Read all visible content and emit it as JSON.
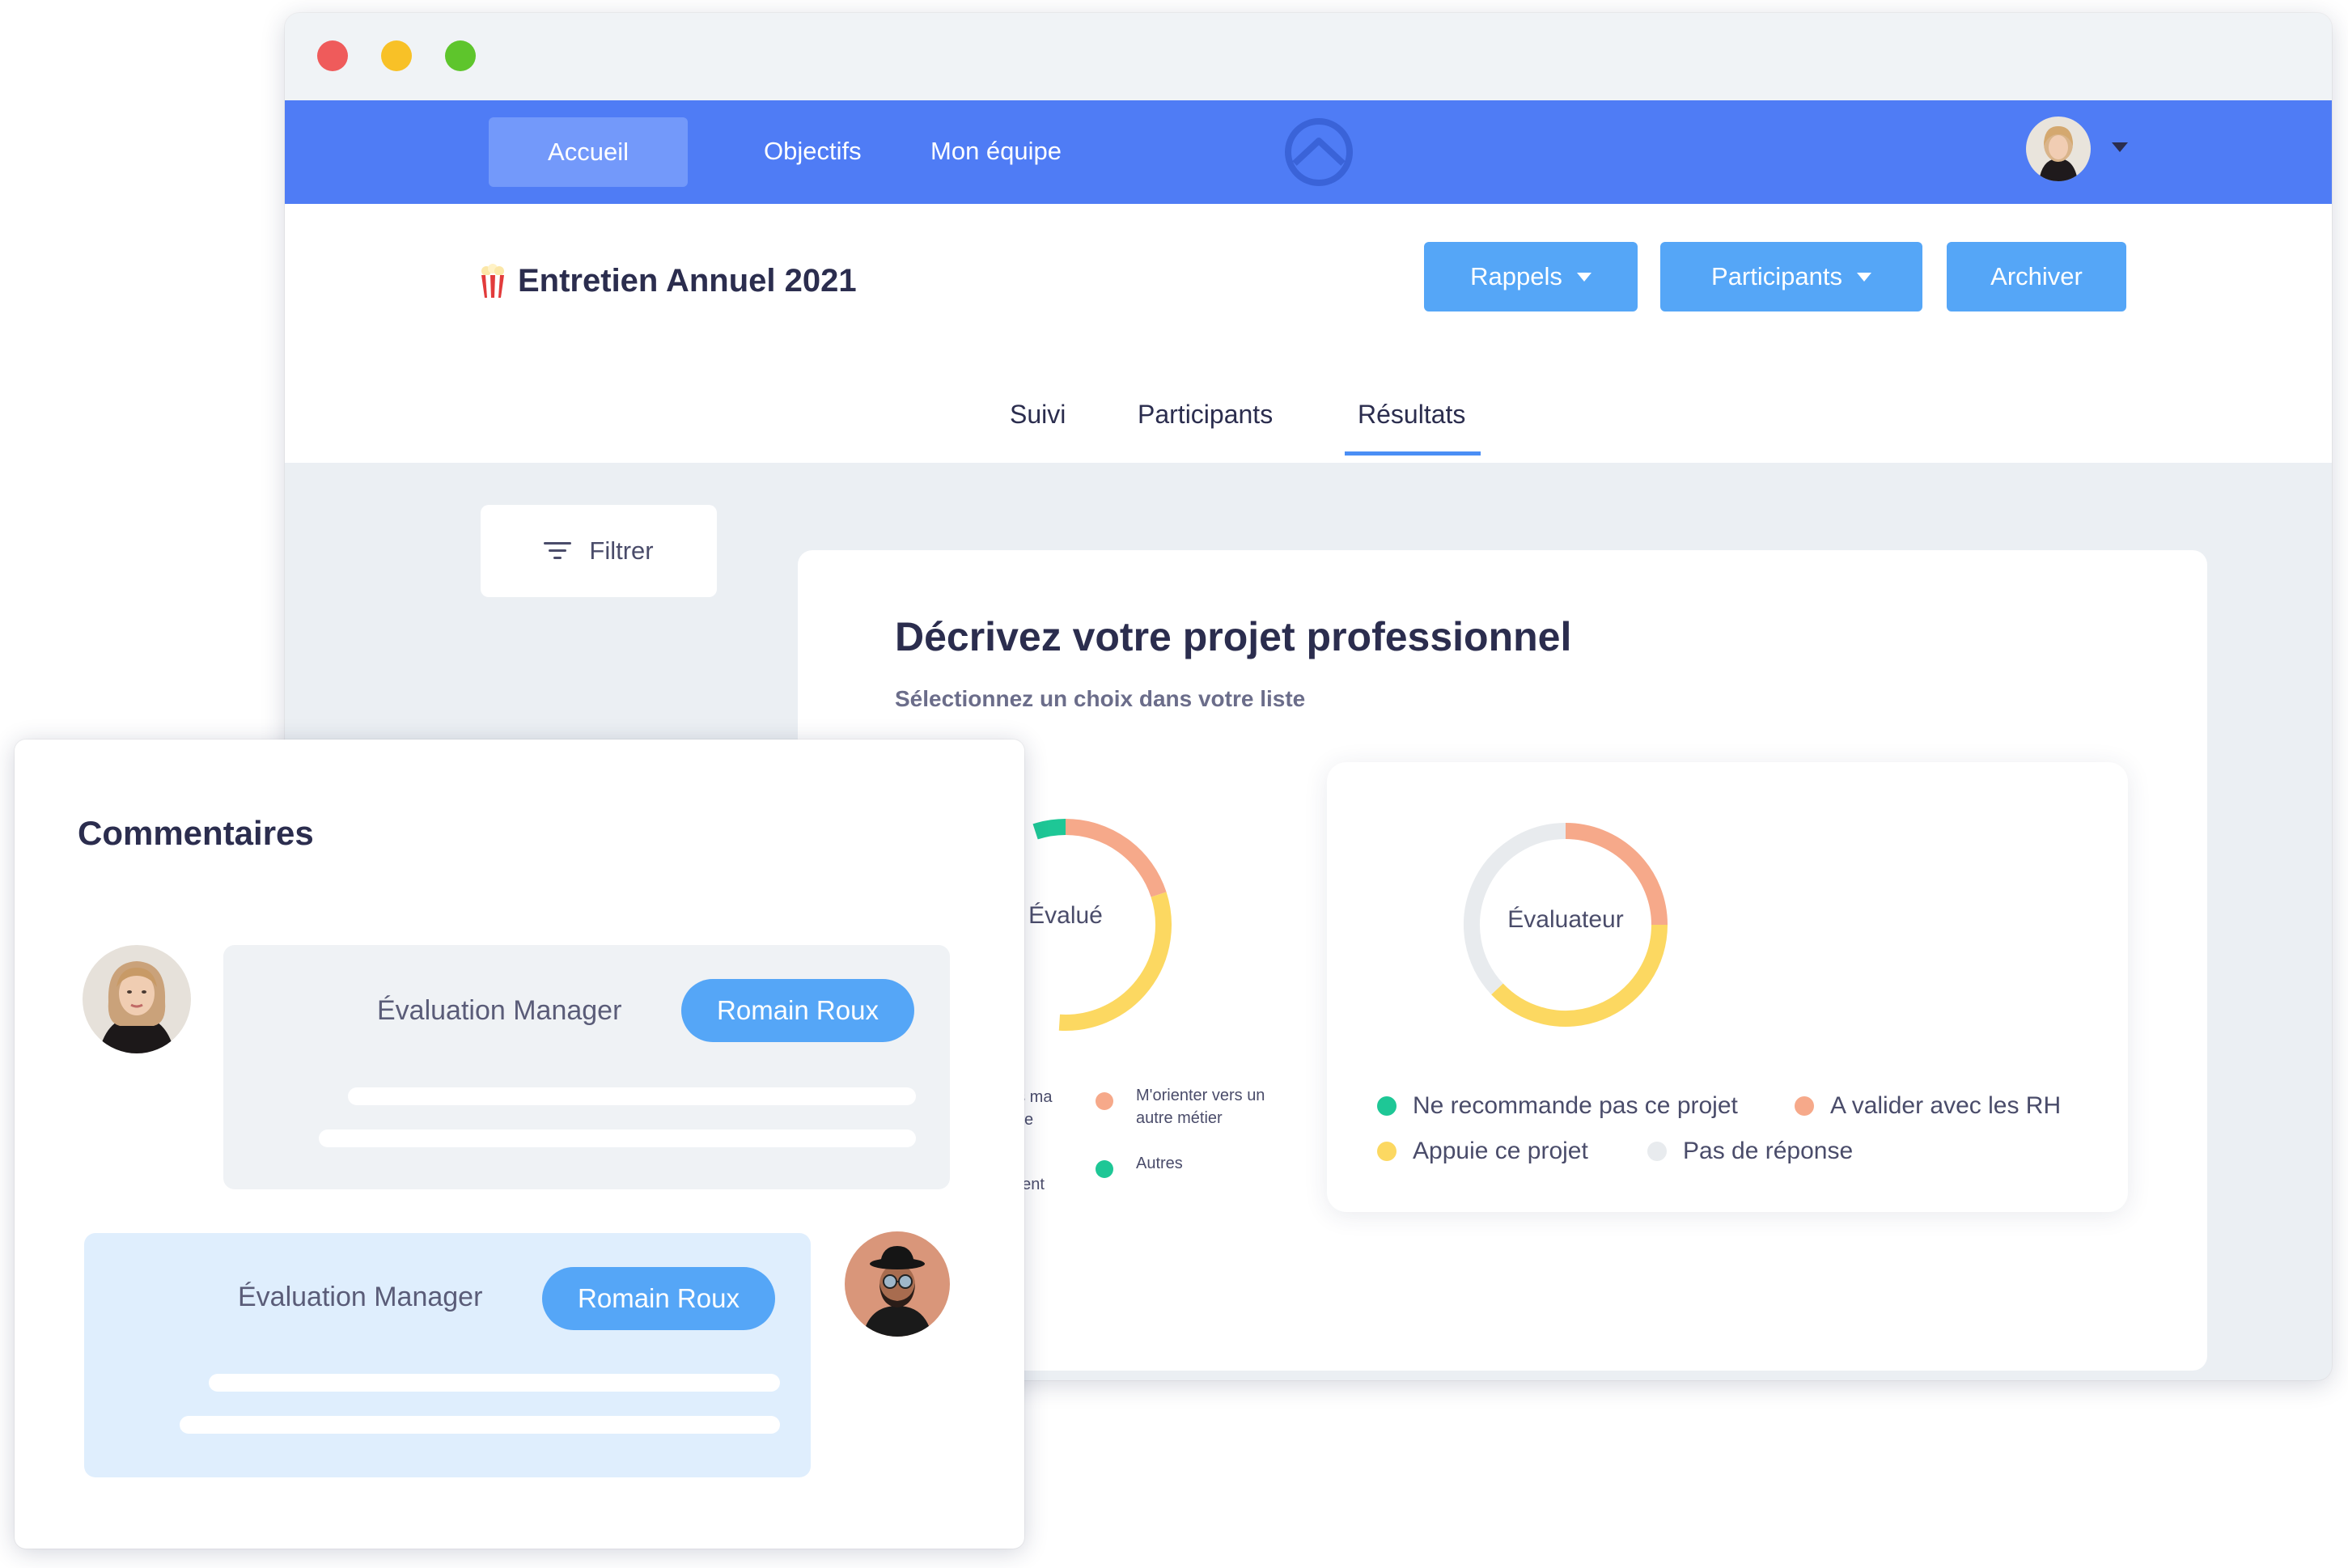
{
  "nav": {
    "items": [
      "Accueil",
      "Objectifs",
      "Mon équipe"
    ],
    "active": "Accueil"
  },
  "header": {
    "title": "Entretien Annuel 2021",
    "buttons": {
      "rappels": "Rappels",
      "participants": "Participants",
      "archiver": "Archiver"
    }
  },
  "tabs": [
    "Suivi",
    "Participants",
    "Résultats"
  ],
  "active_tab": "Résultats",
  "filter": {
    "label": "Filtrer"
  },
  "question": {
    "title": "Décrivez votre projet professionnel",
    "subtitle": "Sélectionnez un choix dans votre liste"
  },
  "chart_data": [
    {
      "type": "pie",
      "title": "Évalué",
      "legend": [
        {
          "label": "ns ma\nelle",
          "color": ""
        },
        {
          "label": "M'orienter vers un autre métier",
          "color": "#f6a98a"
        },
        {
          "label": "nent",
          "color": ""
        },
        {
          "label": "Autres",
          "color": "#1ec796"
        }
      ],
      "visible_segments": [
        {
          "color": "#1ec796",
          "share": 0.05
        },
        {
          "color": "#f6a98a",
          "share": 0.2
        },
        {
          "color": "#fcd861",
          "share": 0.31
        }
      ]
    },
    {
      "type": "pie",
      "title": "Évaluateur",
      "legend": [
        {
          "label": "Ne recommande pas ce projet",
          "color": "#1ec796"
        },
        {
          "label": "A valider avec les RH",
          "color": "#f6a98a"
        },
        {
          "label": "Appuie ce projet",
          "color": "#fcd861"
        },
        {
          "label": "Pas de réponse",
          "color": "#e8ebee"
        }
      ],
      "segments": [
        {
          "label": "A valider avec les RH",
          "share": 0.25,
          "color": "#f6a98a"
        },
        {
          "label": "Appuie ce projet",
          "share": 0.38,
          "color": "#fcd861"
        },
        {
          "label": "Pas de réponse",
          "share": 0.37,
          "color": "#e8ebee"
        }
      ]
    }
  ],
  "comments": {
    "title": "Commentaires",
    "items": [
      {
        "label": "Évaluation Manager",
        "author": "Romain Roux"
      },
      {
        "label": "Évaluation Manager",
        "author": "Romain Roux"
      }
    ]
  },
  "colors": {
    "nav_bg": "#4f7cf5",
    "accent_button": "#55a6f7",
    "tab_underline": "#4a8ef5",
    "text_dark": "#2b2d4e"
  }
}
